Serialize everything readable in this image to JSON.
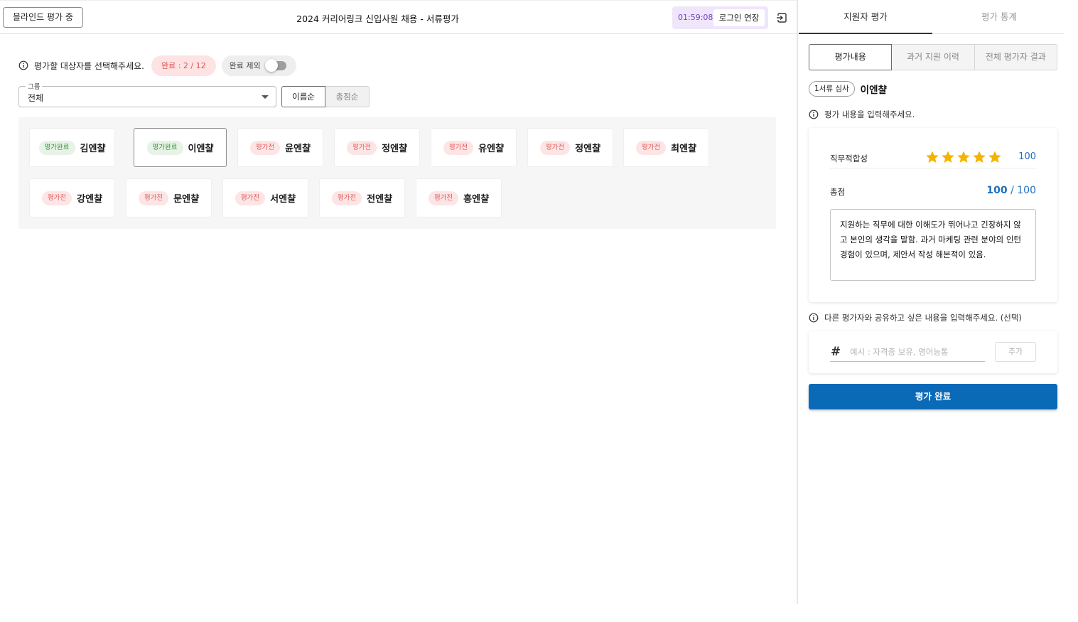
{
  "header": {
    "blind_label": "블라인드 평가 중",
    "title": "2024 커리어링크 신입사원 채용 - 서류평가",
    "timer": "01:59:08",
    "extend_label": "로그인 연장"
  },
  "filters": {
    "instruction": "평가할 대상자를 선택해주세요.",
    "completed_badge": "완료 : 2 / 12",
    "exclude_label": "완료 제외",
    "exclude_on": false,
    "group_label": "그룹",
    "group_value": "전체",
    "sort_options": [
      "이름순",
      "총점순"
    ],
    "sort_selected": "이름순"
  },
  "candidates": [
    {
      "status": "평가완료",
      "state": "done",
      "name": "김엔챨"
    },
    {
      "status": "평가완료",
      "state": "done",
      "name": "이엔챨",
      "selected": true
    },
    {
      "status": "평가전",
      "state": "todo",
      "name": "윤엔챨"
    },
    {
      "status": "평가전",
      "state": "todo",
      "name": "정엔챨"
    },
    {
      "status": "평가전",
      "state": "todo",
      "name": "유엔챨"
    },
    {
      "status": "평가전",
      "state": "todo",
      "name": "정엔챨"
    },
    {
      "status": "평가전",
      "state": "todo",
      "name": "최엔챨"
    },
    {
      "status": "평가전",
      "state": "todo",
      "name": "강엔챨"
    },
    {
      "status": "평가전",
      "state": "todo",
      "name": "문엔챨"
    },
    {
      "status": "평가전",
      "state": "todo",
      "name": "서엔챨"
    },
    {
      "status": "평가전",
      "state": "todo",
      "name": "전엔챨"
    },
    {
      "status": "평가전",
      "state": "todo",
      "name": "홍엔챨"
    }
  ],
  "panel": {
    "tabs": [
      "지원자 평가",
      "평가 통계"
    ],
    "subtabs": [
      "평가내용",
      "과거 지원 이력",
      "전체 평가자 결과"
    ],
    "stage_chip": "1서류 심사",
    "candidate_name": "이엔챨",
    "eval_hint": "평가 내용을 입력해주세요.",
    "criterion_label": "직무적합성",
    "criterion_stars": 5,
    "criterion_score": "100",
    "total_label": "총점",
    "total_score": "100",
    "total_max": "/ 100",
    "comment": "지원하는 직무에 대한 이해도가 뛰어나고 긴장하지 않고 본인의 생각을 말함. 과거 마케팅 관련 분야의 인턴 경험이 있으며, 제안서 작성 해본적이 있음.",
    "share_hint": "다른 평가자와 공유하고 싶은 내용을 입력해주세요. (선택)",
    "tag_placeholder": "예시 : 자격증 보유, 영어능통",
    "add_label": "추가",
    "complete_label": "평가 완료"
  },
  "colors": {
    "primary": "#0b6ab8",
    "score_blue": "#1f6fbd",
    "star": "#f5b301",
    "done_green": "#3a8f3a",
    "todo_red": "#e35b5b",
    "timer_purple": "#7a3fc4"
  }
}
